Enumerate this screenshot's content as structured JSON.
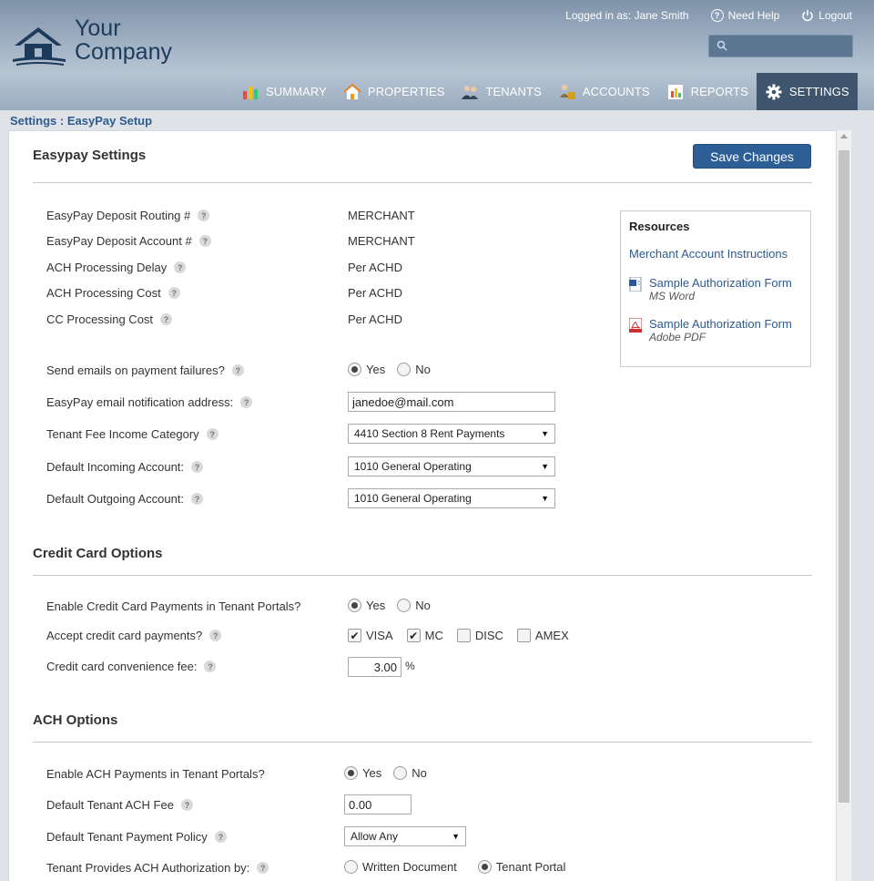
{
  "brand": {
    "line1": "Your",
    "line2": "Company"
  },
  "user": {
    "logged_in_text": "Logged in as:  Jane Smith",
    "help": "Need Help",
    "logout": "Logout"
  },
  "search": {
    "placeholder": ""
  },
  "nav": [
    {
      "label": "SUMMARY",
      "icon": "chart-bar-icon"
    },
    {
      "label": "PROPERTIES",
      "icon": "house-icon"
    },
    {
      "label": "TENANTS",
      "icon": "people-icon"
    },
    {
      "label": "ACCOUNTS",
      "icon": "accounts-icon"
    },
    {
      "label": "REPORTS",
      "icon": "report-icon"
    },
    {
      "label": "SETTINGS",
      "icon": "gear-icon",
      "active": true
    }
  ],
  "breadcrumb": "Settings : EasyPay Setup",
  "save_label": "Save Changes",
  "easypay": {
    "title": "Easypay Settings",
    "rows": [
      {
        "label": "EasyPay Deposit Routing #",
        "value": "MERCHANT"
      },
      {
        "label": "EasyPay Deposit Account #",
        "value": "MERCHANT"
      },
      {
        "label": "ACH Processing Delay",
        "value": "Per ACHD"
      },
      {
        "label": "ACH Processing Cost",
        "value": "Per ACHD"
      },
      {
        "label": "CC Processing Cost",
        "value": "Per ACHD"
      }
    ],
    "send_emails_label": "Send emails on payment failures?",
    "yes": "Yes",
    "no": "No",
    "email_label": "EasyPay email notification address:",
    "email_value": "janedoe@mail.com",
    "fee_cat_label": "Tenant Fee Income Category",
    "fee_cat_value": "4410 Section 8 Rent Payments",
    "incoming_label": "Default Incoming Account:",
    "incoming_value": "1010 General Operating",
    "outgoing_label": "Default Outgoing Account:",
    "outgoing_value": "1010 General Operating"
  },
  "resources": {
    "title": "Resources",
    "merchant_link": "Merchant Account Instructions",
    "word_link": "Sample Authorization Form",
    "word_sub": "MS Word",
    "pdf_link": "Sample Authorization Form",
    "pdf_sub": "Adobe PDF"
  },
  "cc": {
    "title": "Credit Card Options",
    "enable_label": "Enable Credit Card Payments in Tenant Portals?",
    "accept_label": "Accept credit card payments?",
    "cards": [
      {
        "label": "VISA",
        "checked": true
      },
      {
        "label": "MC",
        "checked": true
      },
      {
        "label": "DISC",
        "checked": false
      },
      {
        "label": "AMEX",
        "checked": false
      }
    ],
    "fee_label": "Credit card convenience fee:",
    "fee_value": "3.00",
    "fee_unit": "%"
  },
  "ach": {
    "title": "ACH Options",
    "enable_label": "Enable ACH Payments in Tenant Portals?",
    "fee_label": "Default Tenant ACH Fee",
    "fee_value": "0.00",
    "policy_label": "Default Tenant Payment Policy",
    "policy_value": "Allow Any",
    "auth_label": "Tenant Provides ACH Authorization by:",
    "auth_opt1": "Written Document",
    "auth_opt2": "Tenant Portal"
  },
  "colors": {
    "accent": "#2d5e95",
    "nav_active": "#3f556d",
    "link": "#2d5b8f"
  }
}
